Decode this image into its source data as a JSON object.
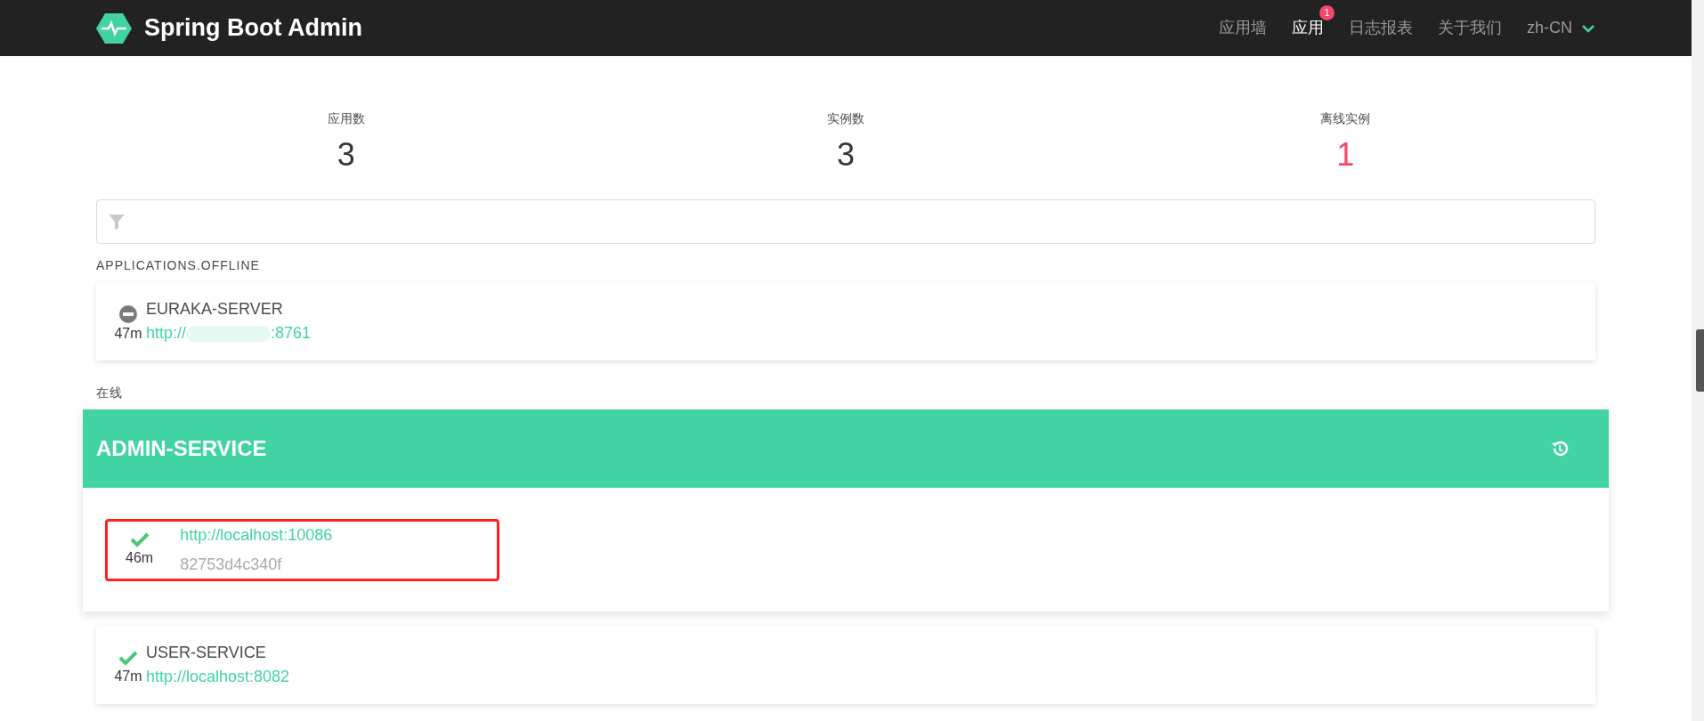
{
  "navbar": {
    "brand": "Spring Boot Admin",
    "items": [
      {
        "label": "应用墙",
        "selected": false
      },
      {
        "label": "应用",
        "selected": true,
        "badge": "1"
      },
      {
        "label": "日志报表",
        "selected": false
      },
      {
        "label": "关于我们",
        "selected": false
      }
    ],
    "language": "zh-CN"
  },
  "stats": [
    {
      "label": "应用数",
      "value": "3",
      "kind": "normal"
    },
    {
      "label": "实例数",
      "value": "3",
      "kind": "normal"
    },
    {
      "label": "离线实例",
      "value": "1",
      "kind": "alert"
    }
  ],
  "groups": [
    {
      "heading": "APPLICATIONS.OFFLINE",
      "applications": [
        {
          "kind": "compact",
          "name": "EURAKA-SERVER",
          "online": false,
          "age": "47m",
          "url_prefix": "http://",
          "url_suffix": ":8761",
          "redacted": true
        }
      ]
    },
    {
      "heading": "在线",
      "applications": [
        {
          "kind": "expanded",
          "name": "ADMIN-SERVICE",
          "instances": [
            {
              "online": true,
              "age": "46m",
              "url": "http://localhost:10086",
              "id": "82753d4c340f",
              "highlighted": true
            }
          ]
        },
        {
          "kind": "compact",
          "name": "USER-SERVICE",
          "online": true,
          "age": "47m",
          "url_prefix": "http://localhost:8082",
          "redacted": false
        }
      ]
    }
  ]
}
